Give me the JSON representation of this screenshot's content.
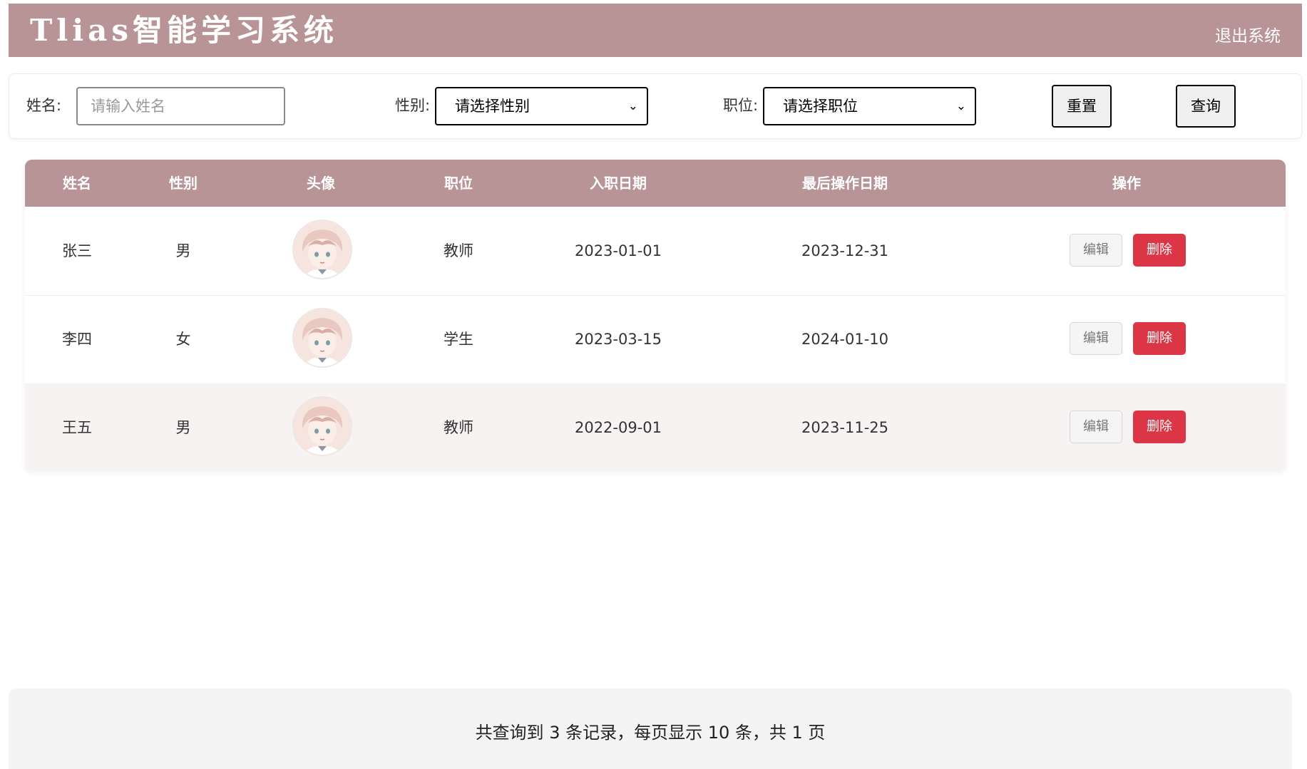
{
  "header": {
    "title": "Tlias智能学习系统",
    "logout_label": "退出系统"
  },
  "search": {
    "name_label": "姓名:",
    "name_placeholder": "请输入姓名",
    "gender_label": "性别:",
    "gender_selected": "请选择性别",
    "position_label": "职位:",
    "position_selected": "请选择职位",
    "reset_label": "重置",
    "query_label": "查询"
  },
  "table": {
    "headers": [
      "姓名",
      "性别",
      "头像",
      "职位",
      "入职日期",
      "最后操作日期",
      "操作"
    ],
    "rows": [
      {
        "name": "张三",
        "gender": "男",
        "position": "教师",
        "entry_date": "2023-01-01",
        "last_op_date": "2023-12-31",
        "edit_label": "编辑",
        "delete_label": "删除"
      },
      {
        "name": "李四",
        "gender": "女",
        "position": "学生",
        "entry_date": "2023-03-15",
        "last_op_date": "2024-01-10",
        "edit_label": "编辑",
        "delete_label": "删除"
      },
      {
        "name": "王五",
        "gender": "男",
        "position": "教师",
        "entry_date": "2022-09-01",
        "last_op_date": "2023-11-25",
        "edit_label": "编辑",
        "delete_label": "删除"
      }
    ]
  },
  "footer": {
    "summary": "共查询到 3 条记录，每页显示 10 条，共 1 页"
  },
  "colors": {
    "header_bg": "#b89496",
    "delete_button": "#dc3545",
    "highlight_row": "#f8f3f3"
  }
}
